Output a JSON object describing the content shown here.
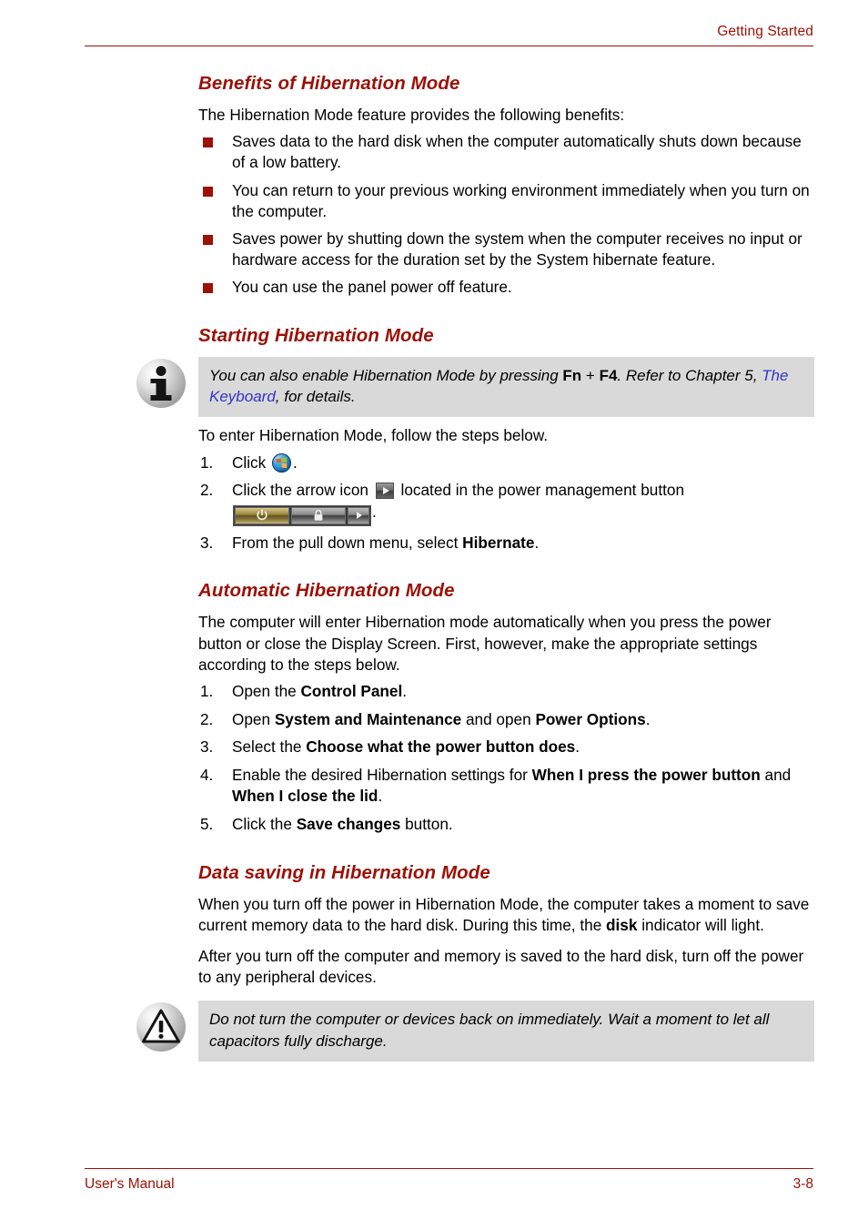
{
  "colors": {
    "accent_red": "#9c1006",
    "link_blue": "#3333cc",
    "callout_bg": "#d9d9d9",
    "bullet_red": "#9c1006"
  },
  "header": {
    "title": "Getting Started"
  },
  "footer": {
    "manual_label": "User's Manual",
    "page_number": "3-8"
  },
  "sections": {
    "benefits": {
      "heading": "Benefits of Hibernation Mode",
      "intro": "The Hibernation Mode feature provides the following benefits:",
      "bullets": [
        "Saves data to the hard disk when the computer automatically shuts down because of a low battery.",
        "You can return to your previous working environment immediately when you turn on the computer.",
        "Saves power by shutting down the system when the computer receives no input or hardware access for the duration set by the System hibernate feature.",
        "You can use the panel power off feature."
      ]
    },
    "starting": {
      "heading": "Starting Hibernation Mode",
      "note": {
        "icon": "info-icon",
        "text_part1": "You can also enable Hibernation Mode by pressing ",
        "key_fn": "Fn",
        "plus": " + ",
        "key_f4": "F4",
        "text_part2": ". Refer to Chapter 5, ",
        "link_text": "The Keyboard",
        "text_part3": ", for details."
      },
      "intro": "To enter Hibernation Mode, follow the steps below.",
      "steps": [
        {
          "number": "1.",
          "text_before": "Click ",
          "icon": "windows-start-orb-icon",
          "text_after": "."
        },
        {
          "number": "2.",
          "text_before": "Click the arrow icon ",
          "icon": "arrow-button-icon",
          "text_middle": " located in the power management button ",
          "icon2": "power-management-button-icon",
          "text_after": "."
        },
        {
          "number": "3.",
          "text_before": "From the pull down menu, select ",
          "bold": "Hibernate",
          "text_after": "."
        }
      ]
    },
    "automatic": {
      "heading": "Automatic Hibernation Mode",
      "intro": "The computer will enter Hibernation mode automatically when you press the power button or close the Display Screen. First, however, make the appropriate settings according to the steps below.",
      "steps": [
        {
          "number": "1.",
          "before": "Open the ",
          "bold1": "Control Panel",
          "middle": "",
          "bold2": "",
          "after": "."
        },
        {
          "number": "2.",
          "before": "Open ",
          "bold1": "System and Maintenance",
          "middle": " and open ",
          "bold2": "Power Options",
          "after": "."
        },
        {
          "number": "3.",
          "before": "Select the ",
          "bold1": "Choose what the power button does",
          "middle": "",
          "bold2": "",
          "after": "."
        },
        {
          "number": "4.",
          "before": "Enable the desired Hibernation settings for ",
          "bold1": "When I press the power button",
          "middle": " and ",
          "bold2": "When I close the lid",
          "after": "."
        },
        {
          "number": "5.",
          "before": "Click the ",
          "bold1": "Save changes",
          "middle": " button",
          "bold2": "",
          "after": "."
        }
      ]
    },
    "data_saving": {
      "heading": "Data saving in Hibernation Mode",
      "para1_before": "When you turn off the power in Hibernation Mode, the computer takes a moment to save current memory data to the hard disk. During this time, the ",
      "para1_bold": "disk",
      "para1_after": " indicator will light.",
      "para2": "After you turn off the computer and memory is saved to the hard disk, turn off the power to any peripheral devices.",
      "caution": {
        "icon": "caution-triangle-icon",
        "text": "Do not turn the computer or devices back on immediately. Wait a moment to let all capacitors fully discharge."
      }
    }
  }
}
